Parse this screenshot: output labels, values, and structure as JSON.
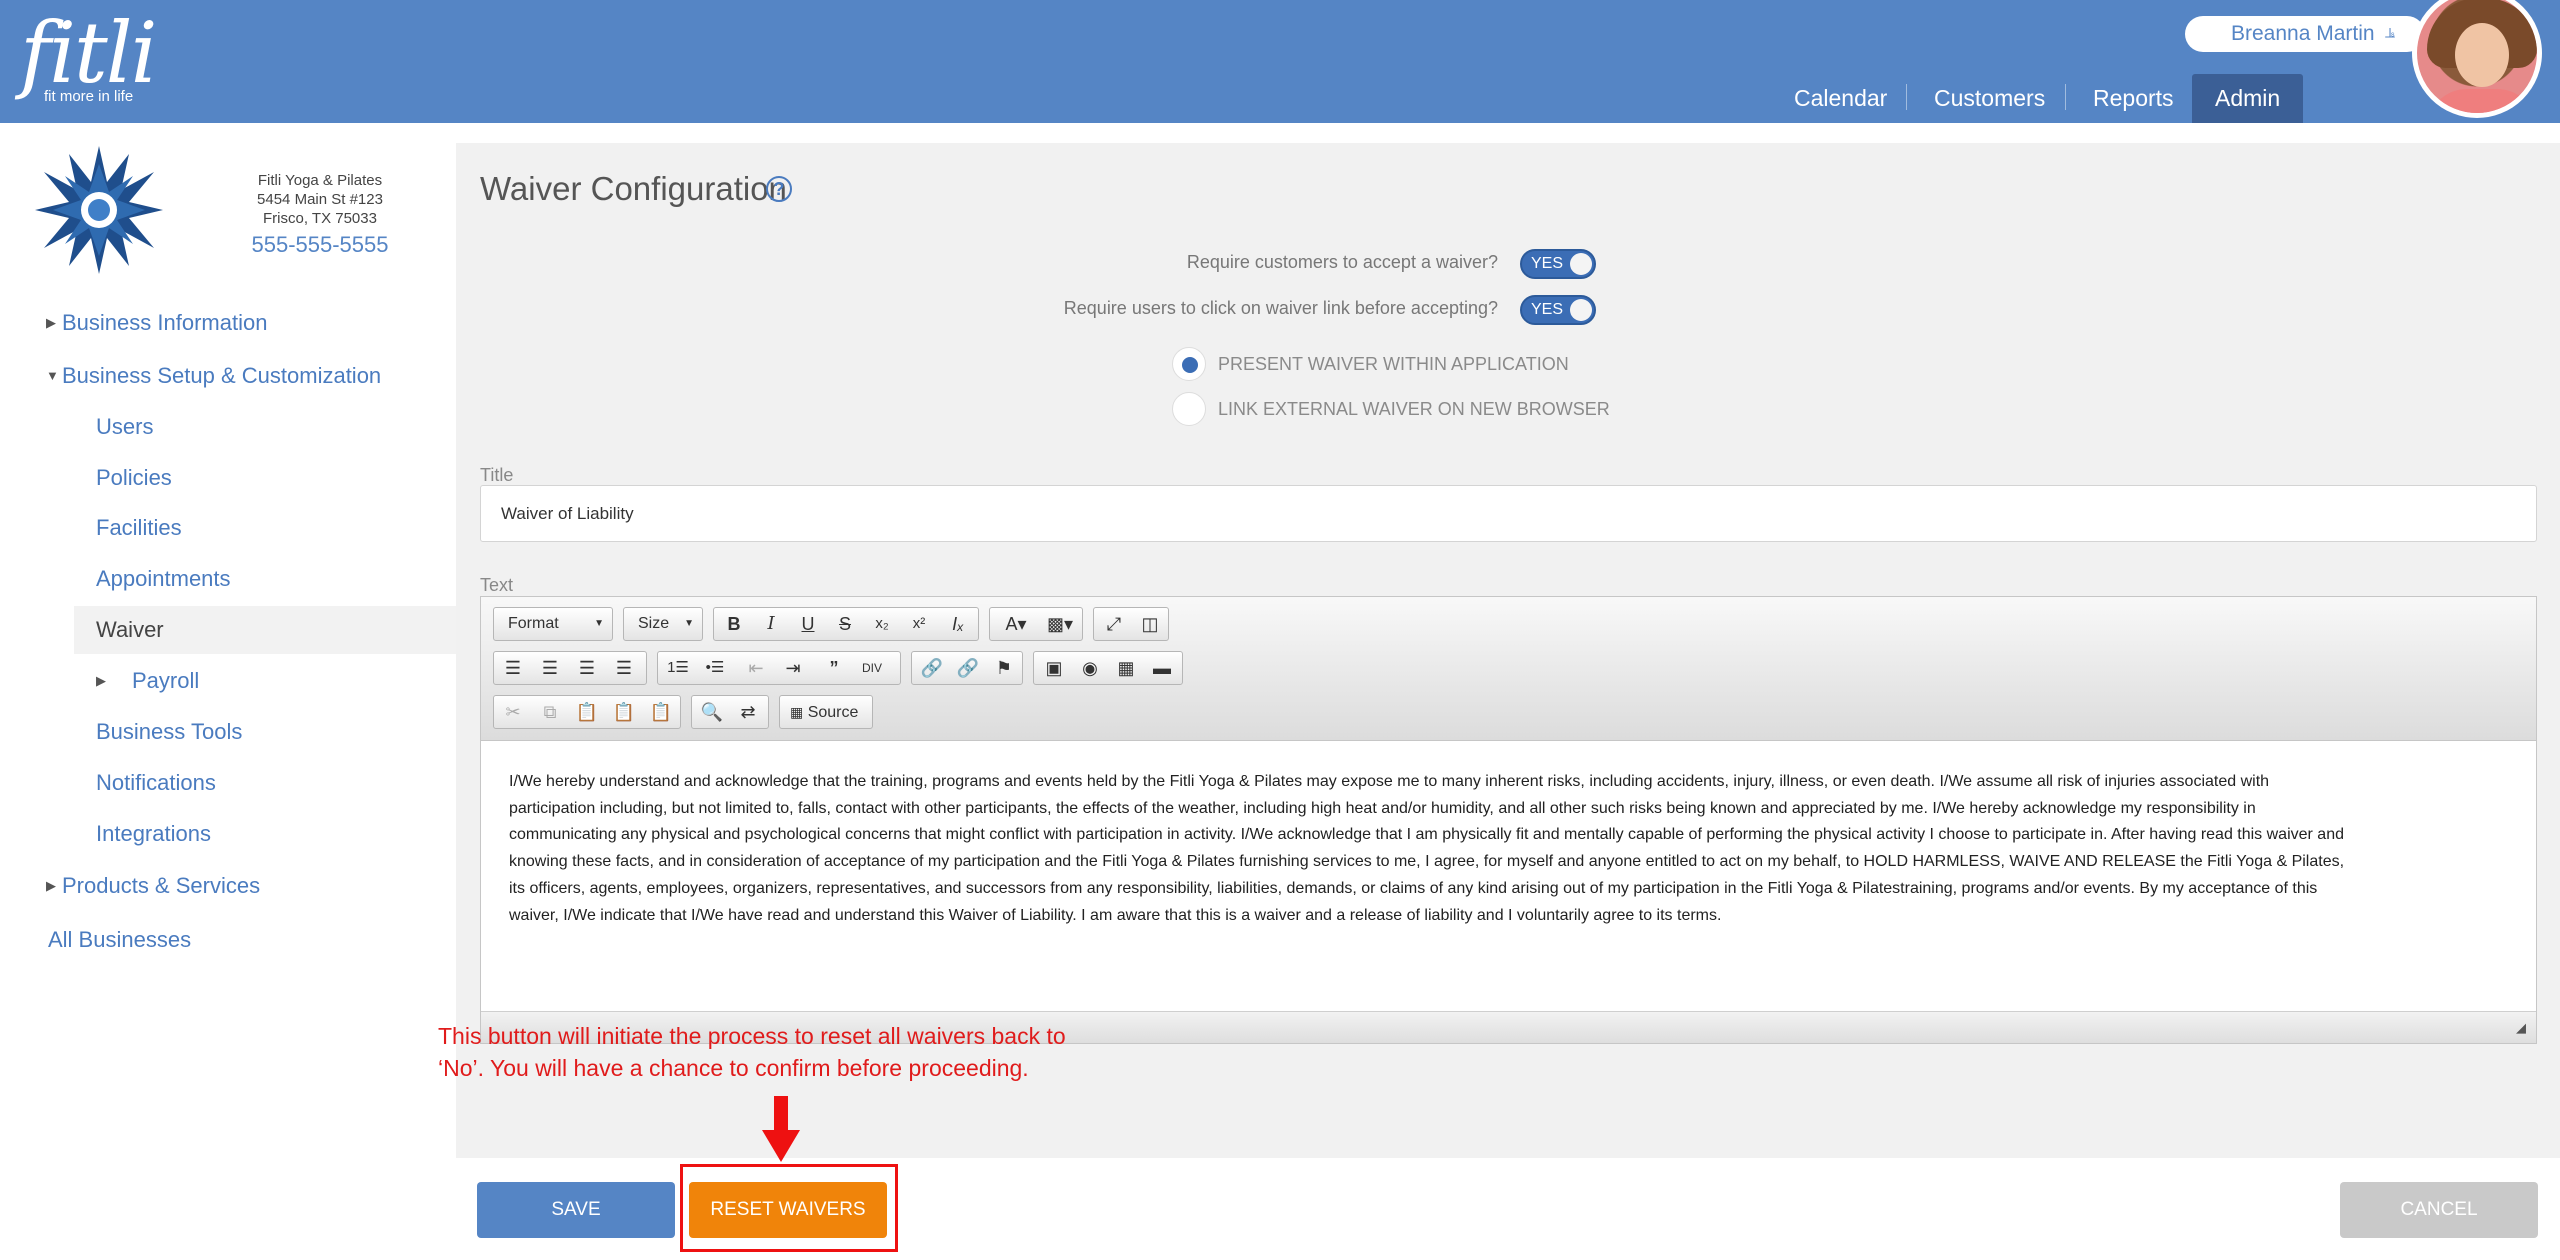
{
  "header": {
    "logo_word": "fitli",
    "logo_tagline": "fit more in life",
    "user_name": "Breanna Martin",
    "nav": [
      "Calendar",
      "Customers",
      "Reports",
      "Admin"
    ]
  },
  "business": {
    "name": "Fitli Yoga & Pilates",
    "address1": "5454 Main St #123",
    "address2": "Frisco, TX 75033",
    "phone": "555-555-5555"
  },
  "sidebar": {
    "items": [
      {
        "label": "Business Information"
      },
      {
        "label": "Business Setup & Customization"
      },
      {
        "label": "Users"
      },
      {
        "label": "Policies"
      },
      {
        "label": "Facilities"
      },
      {
        "label": "Appointments"
      },
      {
        "label": "Waiver"
      },
      {
        "label": "Payroll"
      },
      {
        "label": "Business Tools"
      },
      {
        "label": "Notifications"
      },
      {
        "label": "Integrations"
      },
      {
        "label": "Products & Services"
      },
      {
        "label": "All Businesses"
      }
    ]
  },
  "waiver": {
    "page_title": "Waiver Configuration",
    "help_glyph": "?",
    "require_accept_label": "Require customers to accept a waiver?",
    "require_accept_value": "YES",
    "require_click_label": "Require users to click on waiver link before accepting?",
    "require_click_value": "YES",
    "radio_present": "PRESENT WAIVER WITHIN APPLICATION",
    "radio_link": "LINK EXTERNAL WAIVER ON NEW BROWSER",
    "title_label": "Title",
    "title_value": "Waiver of Liability",
    "text_label": "Text"
  },
  "editor": {
    "format_label": "Format",
    "size_label": "Size",
    "source_label": "Source",
    "body_lines": [
      "I/We hereby understand and acknowledge that the training, programs and events held by the Fitli Yoga & Pilates may expose me to many inherent risks, including accidents, injury, illness, or even death. I/We assume all risk of injuries associated with",
      "participation including, but not limited to, falls, contact with other participants, the effects of the weather, including high heat and/or humidity, and all other such risks being known and appreciated by me. I/We hereby acknowledge my responsibility in",
      "communicating any physical and psychological concerns that might conflict with participation in activity. I/We acknowledge that I am physically fit and mentally capable of performing the physical activity I choose to participate in. After having read this waiver and",
      "knowing these facts, and in consideration of acceptance of my participation and the Fitli Yoga & Pilates furnishing services to me, I agree, for myself and anyone entitled to act on my behalf, to HOLD HARMLESS, WAIVE AND RELEASE the Fitli Yoga & Pilates,",
      "its officers, agents, employees, organizers, representatives, and successors from any responsibility, liabilities, demands, or claims of any kind arising out of my participation in the Fitli Yoga & Pilatestraining, programs and/or events. By my acceptance of this",
      "waiver, I/We indicate that I/We have read and understand this Waiver of Liability. I am aware that this is a waiver and a release of liability and I voluntarily agree to its terms."
    ]
  },
  "annotation": {
    "line1": "This button will initiate the process to reset all waivers back to",
    "line2": "‘No’.  You will have a chance to confirm before proceeding."
  },
  "footer": {
    "save_label": "SAVE",
    "reset_label": "RESET WAIVERS",
    "cancel_label": "CANCEL"
  },
  "colors": {
    "brand_blue": "#5585c5",
    "nav_active": "#3b5f96",
    "reset_orange": "#f0840a",
    "annotation_red": "#e01b1b"
  }
}
